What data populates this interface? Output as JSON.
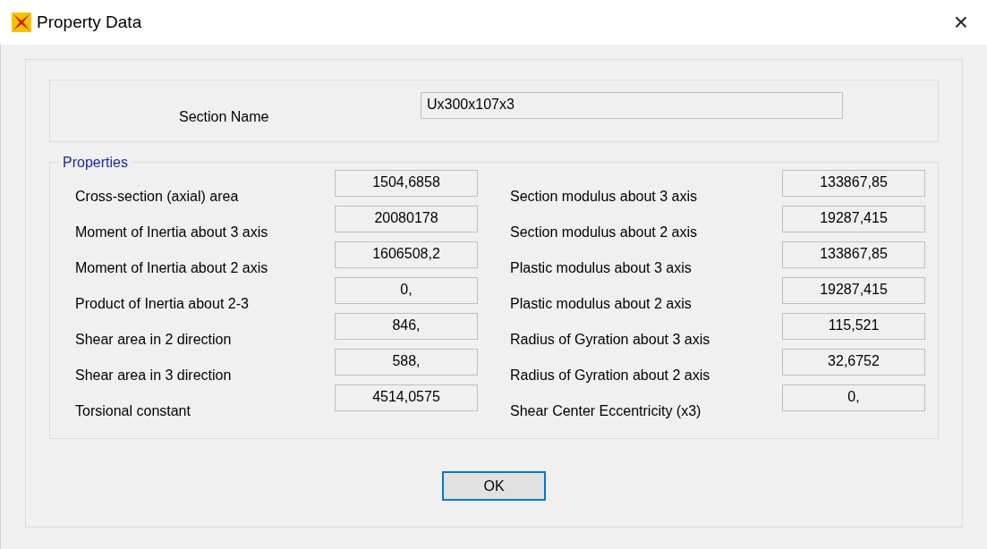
{
  "window": {
    "title": "Property Data",
    "close": "×"
  },
  "section_name": {
    "label": "Section Name",
    "value": "Ux300x107x3"
  },
  "properties": {
    "title": "Properties",
    "left": [
      {
        "label": "Cross-section (axial) area",
        "value": "1504,6858"
      },
      {
        "label": "Moment of Inertia about 3 axis",
        "value": "20080178"
      },
      {
        "label": "Moment of Inertia about 2 axis",
        "value": "1606508,2"
      },
      {
        "label": "Product of Inertia about 2-3",
        "value": "0,"
      },
      {
        "label": "Shear area in 2 direction",
        "value": "846,"
      },
      {
        "label": "Shear area in 3 direction",
        "value": "588,"
      },
      {
        "label": "Torsional constant",
        "value": "4514,0575"
      }
    ],
    "right": [
      {
        "label": "Section modulus about 3 axis",
        "value": "133867,85"
      },
      {
        "label": "Section modulus about 2 axis",
        "value": "19287,415"
      },
      {
        "label": "Plastic modulus about 3 axis",
        "value": "133867,85"
      },
      {
        "label": "Plastic modulus about 2 axis",
        "value": "19287,415"
      },
      {
        "label": "Radius of Gyration about 3 axis",
        "value": "115,521"
      },
      {
        "label": "Radius of Gyration about 2 axis",
        "value": "32,6752"
      },
      {
        "label": "Shear Center Eccentricity (x3)",
        "value": "0,"
      }
    ]
  },
  "buttons": [
    {
      "label": "OK"
    }
  ]
}
